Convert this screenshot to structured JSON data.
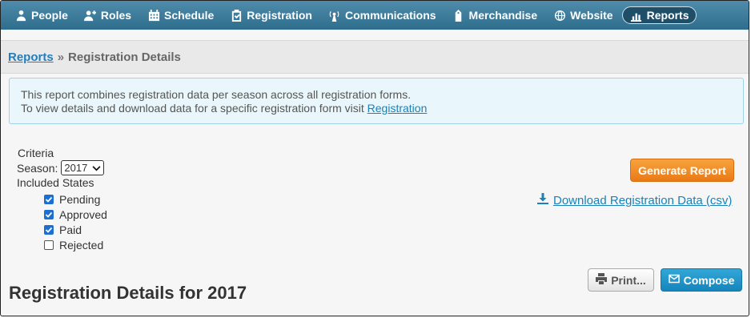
{
  "nav": {
    "items": [
      {
        "label": "People",
        "icon": "people-icon"
      },
      {
        "label": "Roles",
        "icon": "roles-icon"
      },
      {
        "label": "Schedule",
        "icon": "calendar-icon"
      },
      {
        "label": "Registration",
        "icon": "clipboard-check-icon"
      },
      {
        "label": "Communications",
        "icon": "broadcast-icon"
      },
      {
        "label": "Merchandise",
        "icon": "merchandise-tag-icon"
      },
      {
        "label": "Website",
        "icon": "globe-icon"
      },
      {
        "label": "Reports",
        "icon": "bar-chart-icon",
        "active": true
      }
    ]
  },
  "breadcrumb": {
    "root": "Reports",
    "separator": "»",
    "current": "Registration Details"
  },
  "info": {
    "line1": "This report combines registration data per season across all registration forms.",
    "line2_prefix": "To view details and download data for a specific registration form visit",
    "line2_link": "Registration"
  },
  "criteria": {
    "title": "Criteria",
    "season_label": "Season:",
    "season_value": "2017",
    "states_label": "Included States",
    "states": [
      {
        "label": "Pending",
        "checked": true
      },
      {
        "label": "Approved",
        "checked": true
      },
      {
        "label": "Paid",
        "checked": true
      },
      {
        "label": "Rejected",
        "checked": false
      }
    ]
  },
  "actions": {
    "generate": "Generate Report",
    "download": "Download Registration Data (csv)",
    "print": "Print...",
    "compose": "Compose"
  },
  "heading": "Registration Details for 2017",
  "colors": {
    "nav": "#3b7a9a",
    "accent_orange": "#f08a24",
    "link": "#1a82b8",
    "compose": "#1c8ec7"
  }
}
